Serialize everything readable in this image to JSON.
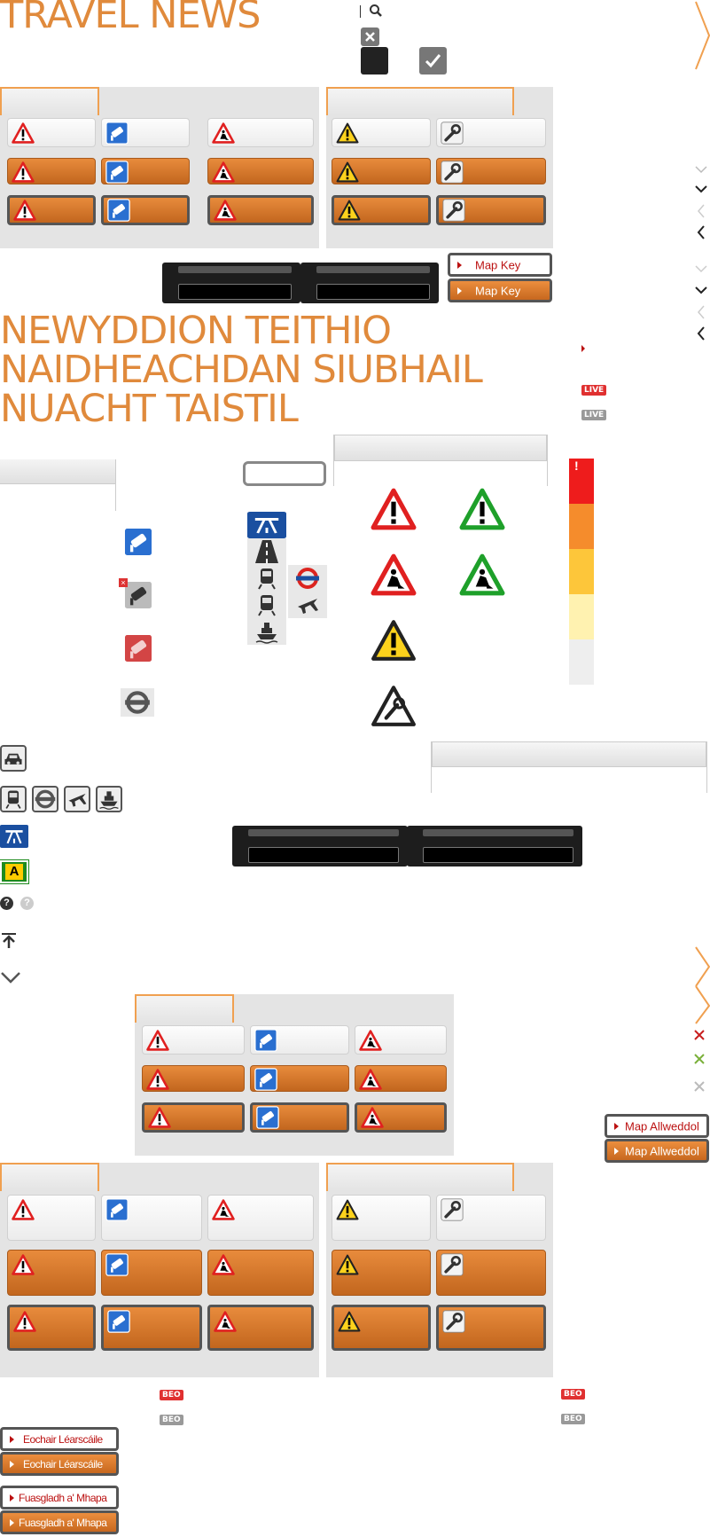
{
  "titles": {
    "main": "TRAVEL NEWS",
    "welsh": "NEWYDDION TEITHIO",
    "gaelic": "NAIDHEACHDAN SIUBHAIL",
    "irish": "NUACHT TAISTIL"
  },
  "buttons": {
    "map_key": "Map Key",
    "map_key_welsh": "Map Allweddol",
    "map_key_irish": "Eochair Léarscáile",
    "map_key_gaelic": "Fuasgladh a' Mhapa"
  },
  "badges": {
    "live": "LIVE",
    "live_welsh": "BEO"
  },
  "road_sign": "A",
  "severity_mark": "!",
  "colors": {
    "accent": "#e08a3c",
    "button_orange": "#d27530",
    "live_red": "#e03030",
    "live_grey": "#999999",
    "severity": [
      "#ee1c1c",
      "#f58c2c",
      "#fdc63a",
      "#fff2b0",
      "#eeeeee"
    ]
  },
  "icons": [
    "search-icon",
    "close-icon",
    "check-icon",
    "warning-icon",
    "camera-icon",
    "roadworks-icon",
    "wrench-icon",
    "motorway-icon",
    "road-icon",
    "train-icon",
    "tube-icon",
    "plane-icon",
    "ferry-icon",
    "car-icon",
    "help-icon",
    "back-to-top-icon",
    "chevron-down-icon",
    "chevron-left-icon",
    "chevron-right-icon"
  ]
}
